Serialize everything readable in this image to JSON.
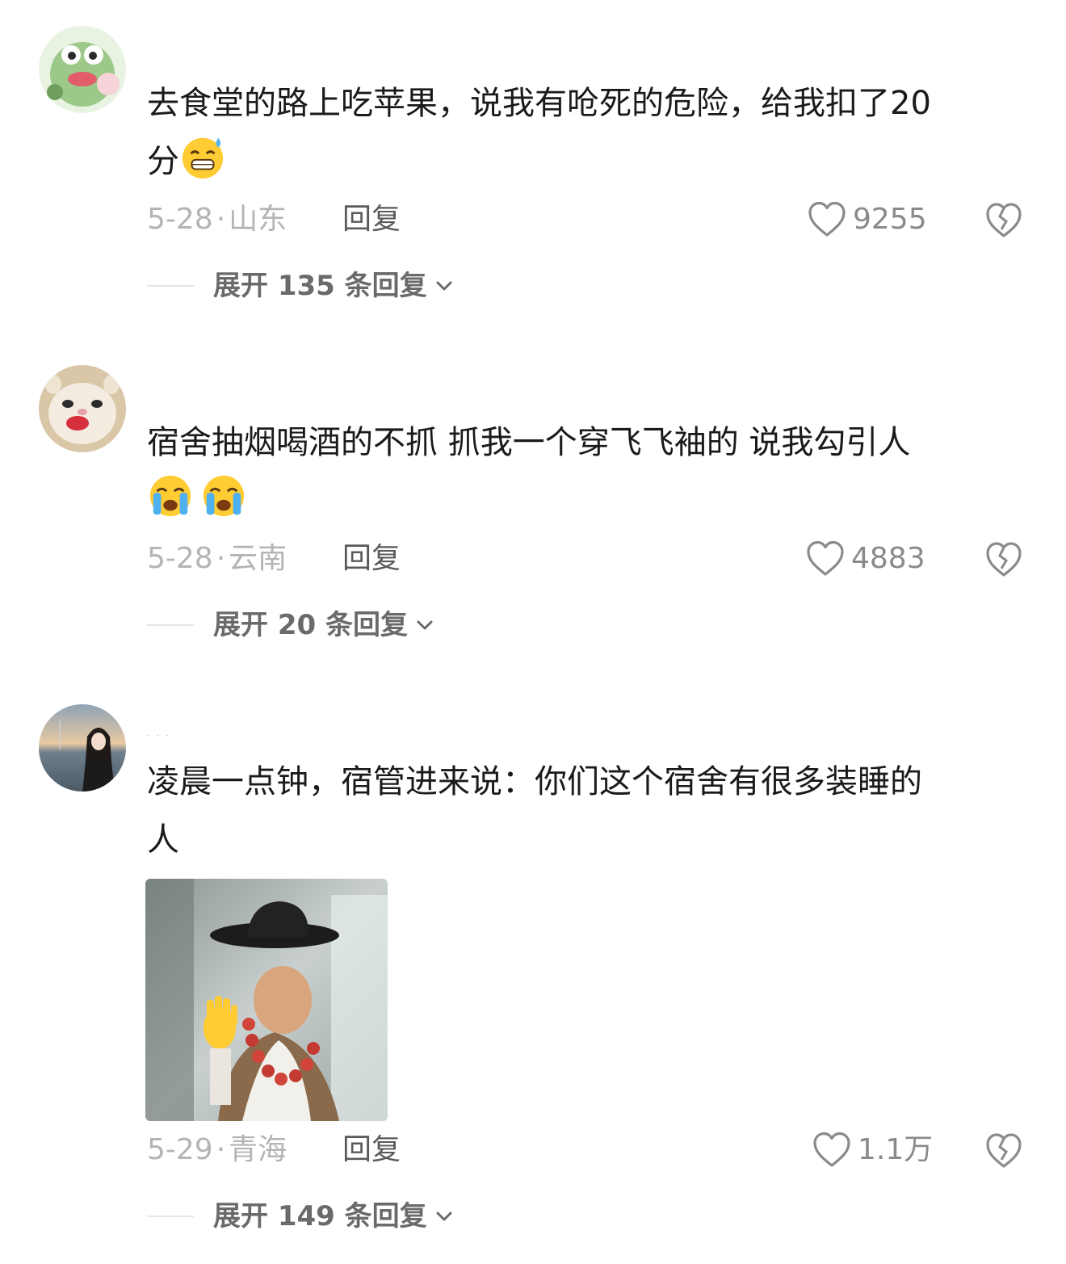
{
  "comments": [
    {
      "avatar": "frog-cartoon-avatar",
      "text": "去食堂的路上吃苹果，说我有呛死的危险，给我扣了20分",
      "text_line1": "去食堂的路上吃苹果，说我有呛死的危险，给我扣了20",
      "text_line2": "分",
      "emojis": [
        "grin-sweat-emoji"
      ],
      "date": "5-28",
      "region": "山东",
      "reply_label": "回复",
      "likes": "9255",
      "expand_label": "展开 135 条回复"
    },
    {
      "avatar": "ferret-lipstick-avatar",
      "text": "宿舍抽烟喝酒的不抓 抓我一个穿飞飞袖的 说我勾引人",
      "text_line1": "宿舍抽烟喝酒的不抓 抓我一个穿飞飞袖的 说我勾引人",
      "emojis": [
        "loudly-crying-emoji",
        "loudly-crying-emoji"
      ],
      "date": "5-28",
      "region": "云南",
      "reply_label": "回复",
      "likes": "4883",
      "expand_label": "展开 20 条回复"
    },
    {
      "avatar": "sunset-portrait-avatar",
      "username": "· · ·",
      "text": "凌晨一点钟，宿管进来说：你们这个宿舍有很多装睡的人",
      "text_line1": "凌晨一点钟，宿管进来说：你们这个宿舍有很多装睡的",
      "text_line2": "人",
      "attachment": "cowboy-hat-wave-meme-image",
      "date": "5-29",
      "region": "青海",
      "reply_label": "回复",
      "likes": "1.1万",
      "expand_label": "展开 149 条回复"
    }
  ],
  "icons": {
    "like": "heart-outline-icon",
    "dislike": "broken-heart-icon",
    "expand": "chevron-down-icon"
  },
  "colors": {
    "text": "#1a1a1a",
    "meta": "#b4b4b4",
    "reply": "#5a5a5a",
    "count": "#8a8a8a",
    "expand": "#6a6a6a"
  }
}
